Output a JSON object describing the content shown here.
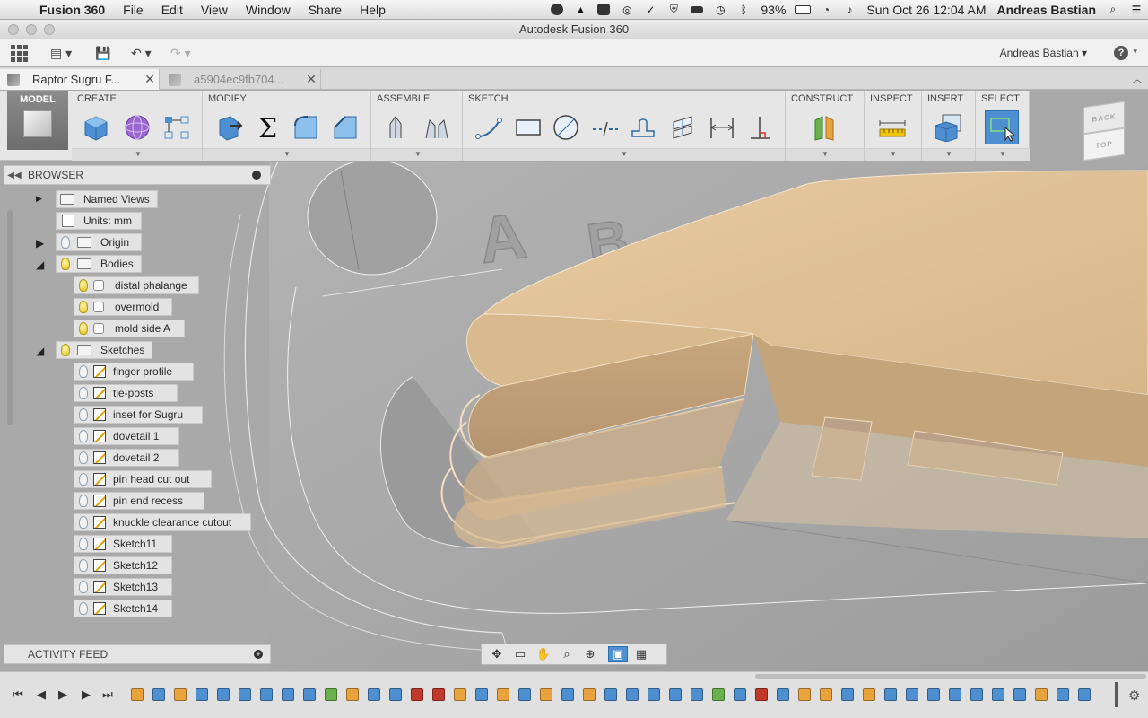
{
  "menubar": {
    "app_name": "Fusion 360",
    "menus": [
      "File",
      "Edit",
      "View",
      "Window",
      "Share",
      "Help"
    ],
    "battery": "93%",
    "clock": "Sun Oct 26  12:04 AM",
    "user": "Andreas Bastian"
  },
  "window": {
    "title": "Autodesk Fusion 360"
  },
  "app_toolbar": {
    "user_menu": "Andreas Bastian ▾",
    "help": "?"
  },
  "tabs": [
    {
      "label": "Raptor Sugru F...",
      "active": true
    },
    {
      "label": "a5904ec9fb704...",
      "active": false
    }
  ],
  "ribbon": {
    "workspace": "MODEL",
    "groups": [
      "CREATE",
      "MODIFY",
      "ASSEMBLE",
      "SKETCH",
      "CONSTRUCT",
      "INSPECT",
      "INSERT",
      "SELECT"
    ]
  },
  "viewcube": {
    "back": "BACK",
    "top": "TOP"
  },
  "browser": {
    "title": "BROWSER",
    "nodes": [
      {
        "label": "Named Views"
      },
      {
        "label": "Units: mm"
      },
      {
        "label": "Origin"
      },
      {
        "label": "Bodies"
      },
      {
        "label": "distal phalange"
      },
      {
        "label": "overmold"
      },
      {
        "label": "mold side A"
      },
      {
        "label": "Sketches"
      },
      {
        "label": "finger profile"
      },
      {
        "label": "tie-posts"
      },
      {
        "label": "inset for Sugru"
      },
      {
        "label": "dovetail 1"
      },
      {
        "label": "dovetail 2"
      },
      {
        "label": "pin head cut out"
      },
      {
        "label": "pin end recess"
      },
      {
        "label": "knuckle clearance cutout"
      },
      {
        "label": "Sketch11"
      },
      {
        "label": "Sketch12"
      },
      {
        "label": "Sketch13"
      },
      {
        "label": "Sketch14"
      }
    ]
  },
  "activity_feed": {
    "title": "ACTIVITY FEED"
  },
  "colors": {
    "body": "#dcbc92",
    "mold": "#a9a9a9",
    "select_blue": "#4d8fd0"
  }
}
